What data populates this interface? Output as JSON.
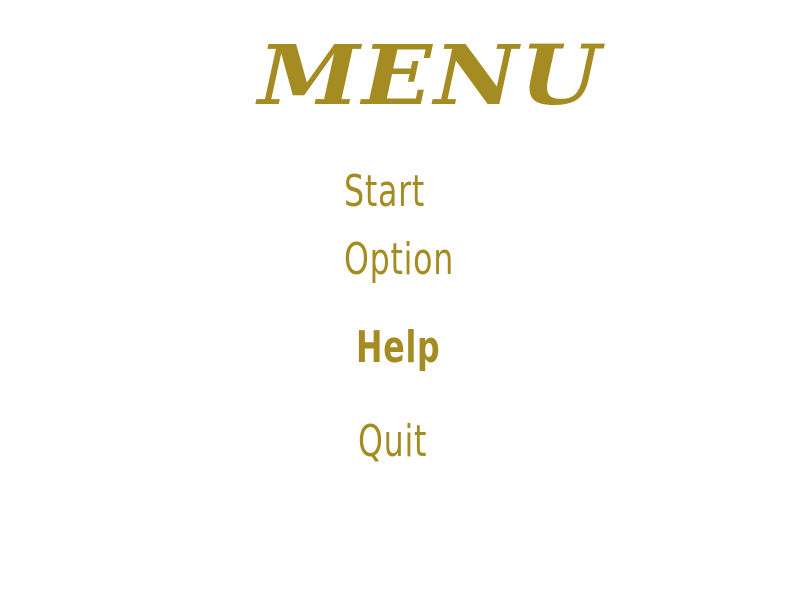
{
  "title": "MENU",
  "menu": {
    "items": [
      {
        "label": "Start"
      },
      {
        "label": "Option"
      },
      {
        "label": "Help"
      },
      {
        "label": "Quit"
      }
    ]
  },
  "colors": {
    "text": "#a58c22",
    "background": "#ffffff"
  }
}
